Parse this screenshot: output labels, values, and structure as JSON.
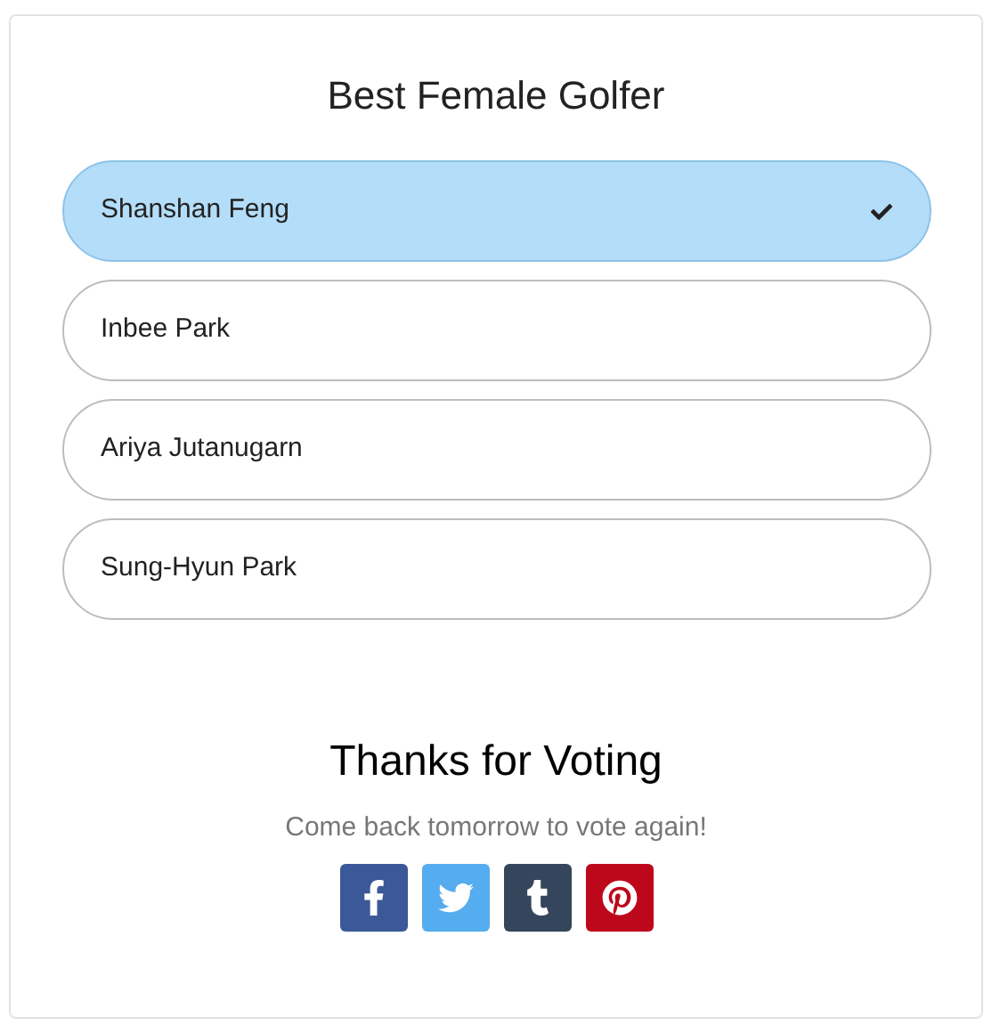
{
  "poll": {
    "title": "Best Female Golfer",
    "options": [
      {
        "label": "Shanshan Feng",
        "selected": true
      },
      {
        "label": "Inbee Park",
        "selected": false
      },
      {
        "label": "Ariya Jutanugarn",
        "selected": false
      },
      {
        "label": "Sung-Hyun Park",
        "selected": false
      }
    ]
  },
  "result": {
    "heading": "Thanks for Voting",
    "message": "Come back tomorrow to vote again!"
  },
  "share_buttons": [
    {
      "kind": "facebook",
      "color": "#3b5998"
    },
    {
      "kind": "twitter",
      "color": "#55acee"
    },
    {
      "kind": "tumblr",
      "color": "#35465c"
    },
    {
      "kind": "pinterest",
      "color": "#bd081c"
    }
  ]
}
